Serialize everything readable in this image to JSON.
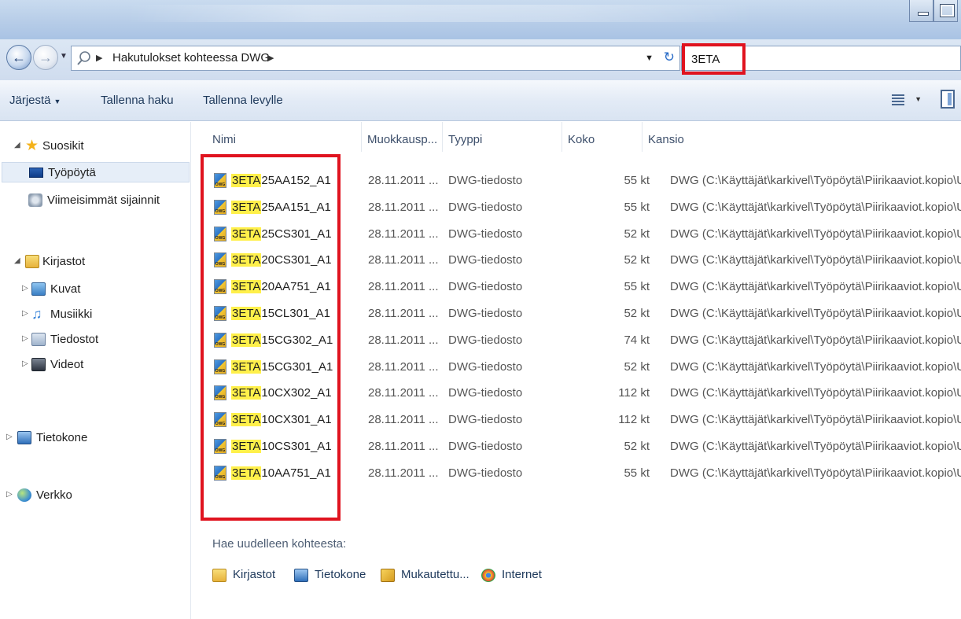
{
  "window": {
    "title_glare": ""
  },
  "address": {
    "breadcrumb": "Hakutulokset kohteessa DWG",
    "breadcrumb_sep": "▶",
    "search_value": "3ETA"
  },
  "toolbar": {
    "organize": "Järjestä",
    "save_search": "Tallenna haku",
    "burn": "Tallenna levylle"
  },
  "navpane": {
    "favorites": "Suosikit",
    "desktop": "Työpöytä",
    "recent": "Viimeisimmät sijainnit",
    "libraries": "Kirjastot",
    "pictures": "Kuvat",
    "music": "Musiikki",
    "documents": "Tiedostot",
    "videos": "Videot",
    "computer": "Tietokone",
    "network": "Verkko"
  },
  "columns": {
    "name": "Nimi",
    "modified": "Muokkausp...",
    "type": "Tyyppi",
    "size": "Koko",
    "folder": "Kansio"
  },
  "files": [
    {
      "prefix": "3ETA",
      "rest": "25AA152_A1",
      "date": "28.11.2011 ...",
      "type": "DWG-tiedosto",
      "size": "55 kt",
      "folder": "DWG (C:\\Käyttäjät\\karkivel\\Työpöytä\\Piirikaaviot.kopio\\UU"
    },
    {
      "prefix": "3ETA",
      "rest": "25AA151_A1",
      "date": "28.11.2011 ...",
      "type": "DWG-tiedosto",
      "size": "55 kt",
      "folder": "DWG (C:\\Käyttäjät\\karkivel\\Työpöytä\\Piirikaaviot.kopio\\UU"
    },
    {
      "prefix": "3ETA",
      "rest": "25CS301_A1",
      "date": "28.11.2011 ...",
      "type": "DWG-tiedosto",
      "size": "52 kt",
      "folder": "DWG (C:\\Käyttäjät\\karkivel\\Työpöytä\\Piirikaaviot.kopio\\UU"
    },
    {
      "prefix": "3ETA",
      "rest": "20CS301_A1",
      "date": "28.11.2011 ...",
      "type": "DWG-tiedosto",
      "size": "52 kt",
      "folder": "DWG (C:\\Käyttäjät\\karkivel\\Työpöytä\\Piirikaaviot.kopio\\UU"
    },
    {
      "prefix": "3ETA",
      "rest": "20AA751_A1",
      "date": "28.11.2011 ...",
      "type": "DWG-tiedosto",
      "size": "55 kt",
      "folder": "DWG (C:\\Käyttäjät\\karkivel\\Työpöytä\\Piirikaaviot.kopio\\UU"
    },
    {
      "prefix": "3ETA",
      "rest": "15CL301_A1",
      "date": "28.11.2011 ...",
      "type": "DWG-tiedosto",
      "size": "52 kt",
      "folder": "DWG (C:\\Käyttäjät\\karkivel\\Työpöytä\\Piirikaaviot.kopio\\UU"
    },
    {
      "prefix": "3ETA",
      "rest": "15CG302_A1",
      "date": "28.11.2011 ...",
      "type": "DWG-tiedosto",
      "size": "74 kt",
      "folder": "DWG (C:\\Käyttäjät\\karkivel\\Työpöytä\\Piirikaaviot.kopio\\UU"
    },
    {
      "prefix": "3ETA",
      "rest": "15CG301_A1",
      "date": "28.11.2011 ...",
      "type": "DWG-tiedosto",
      "size": "52 kt",
      "folder": "DWG (C:\\Käyttäjät\\karkivel\\Työpöytä\\Piirikaaviot.kopio\\UU"
    },
    {
      "prefix": "3ETA",
      "rest": "10CX302_A1",
      "date": "28.11.2011 ...",
      "type": "DWG-tiedosto",
      "size": "112 kt",
      "folder": "DWG (C:\\Käyttäjät\\karkivel\\Työpöytä\\Piirikaaviot.kopio\\UU"
    },
    {
      "prefix": "3ETA",
      "rest": "10CX301_A1",
      "date": "28.11.2011 ...",
      "type": "DWG-tiedosto",
      "size": "112 kt",
      "folder": "DWG (C:\\Käyttäjät\\karkivel\\Työpöytä\\Piirikaaviot.kopio\\UU"
    },
    {
      "prefix": "3ETA",
      "rest": "10CS301_A1",
      "date": "28.11.2011 ...",
      "type": "DWG-tiedosto",
      "size": "52 kt",
      "folder": "DWG (C:\\Käyttäjät\\karkivel\\Työpöytä\\Piirikaaviot.kopio\\UU"
    },
    {
      "prefix": "3ETA",
      "rest": "10AA751_A1",
      "date": "28.11.2011 ...",
      "type": "DWG-tiedosto",
      "size": "55 kt",
      "folder": "DWG (C:\\Käyttäjät\\karkivel\\Työpöytä\\Piirikaaviot.kopio\\UU"
    }
  ],
  "search_again": {
    "label": "Hae uudelleen kohteesta:",
    "libraries": "Kirjastot",
    "computer": "Tietokone",
    "custom": "Mukautettu...",
    "internet": "Internet"
  },
  "colors": {
    "annotation_red": "#e0131f",
    "match_highlight": "#fff04a"
  }
}
